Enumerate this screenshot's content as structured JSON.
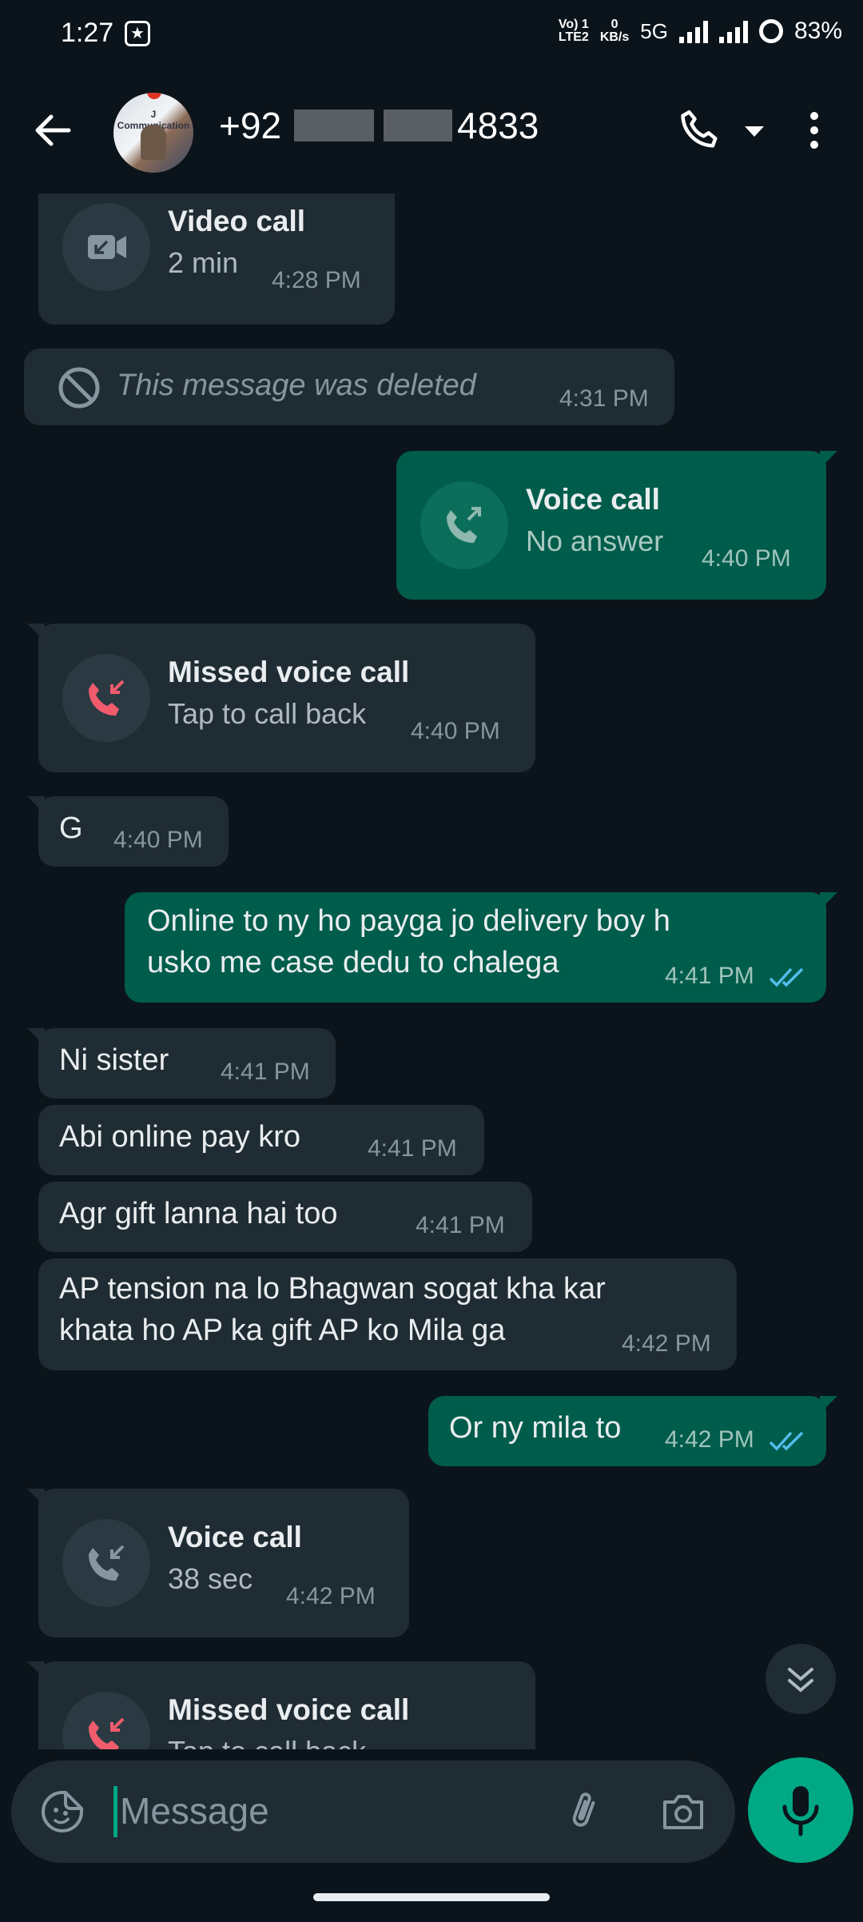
{
  "status_bar": {
    "time": "1:27",
    "net_top": "Vo) 1",
    "net_bottom": "LTE2",
    "speed_top": "0",
    "speed_bottom": "KB/s",
    "network": "5G",
    "battery": "83%"
  },
  "header": {
    "contact_prefix": "+92",
    "contact_suffix": "4833",
    "avatar_text": "J Communication"
  },
  "messages": {
    "m1": {
      "title": "Video call",
      "sub": "2 min",
      "time": "4:28 PM"
    },
    "m2": {
      "text": "This message was deleted",
      "time": "4:31 PM"
    },
    "m3": {
      "title": "Voice call",
      "sub": "No answer",
      "time": "4:40 PM"
    },
    "m4": {
      "title": "Missed voice call",
      "sub": "Tap to call back",
      "time": "4:40 PM"
    },
    "m5": {
      "text": "G",
      "time": "4:40 PM"
    },
    "m6": {
      "line1": "Online to ny ho payga jo delivery boy h",
      "line2": "usko me case dedu to chalega",
      "time": "4:41 PM"
    },
    "m7": {
      "text": "Ni sister",
      "time": "4:41 PM"
    },
    "m8": {
      "text": "Abi online pay kro",
      "time": "4:41 PM"
    },
    "m9": {
      "text": "Agr gift lanna hai too",
      "time": "4:41 PM"
    },
    "m10": {
      "line1": "AP tension na lo Bhagwan sogat kha kar",
      "line2": "khata ho AP ka gift AP ko Mila ga",
      "time": "4:42 PM"
    },
    "m11": {
      "text": "Or ny mila to",
      "time": "4:42 PM"
    },
    "m12": {
      "title": "Voice call",
      "sub": "38 sec",
      "time": "4:42 PM"
    },
    "m13": {
      "title": "Missed voice call",
      "sub": "Tap to call back"
    }
  },
  "input": {
    "placeholder": "Message"
  },
  "colors": {
    "incoming": "#202c33",
    "outgoing": "#005c4b",
    "accent": "#00a884",
    "missed": "#f15c6d",
    "read_ticks": "#53bdeb"
  },
  "icons": [
    "back-arrow-icon",
    "phone-icon",
    "dropdown-caret-icon",
    "more-options-icon",
    "video-call-icon",
    "blocked-icon",
    "outgoing-call-icon",
    "missed-call-icon",
    "incoming-call-icon",
    "double-check-icon",
    "scroll-down-icon",
    "emoji-sticker-icon",
    "attach-icon",
    "camera-icon",
    "mic-icon"
  ]
}
